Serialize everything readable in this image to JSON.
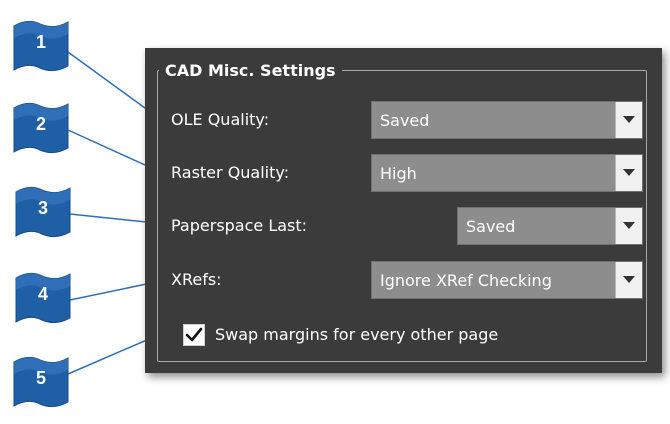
{
  "group": {
    "title": "CAD Misc. Settings"
  },
  "fields": [
    {
      "label": "OLE Quality:",
      "value": "Saved"
    },
    {
      "label": "Raster Quality:",
      "value": "High"
    },
    {
      "label": "Paperspace Last:",
      "value": "Saved"
    },
    {
      "label": "XRefs:",
      "value": "Ignore XRef Checking"
    }
  ],
  "swap_margins": {
    "label": "Swap margins for every other page",
    "checked": true
  },
  "callouts": [
    "1",
    "2",
    "3",
    "4",
    "5"
  ],
  "colors": {
    "panel": "#3b3b3b",
    "combo": "#8d8d8d",
    "callout_blue": "#1f5fa5",
    "leader_line": "#2f6fb5",
    "dot": "#cc1f1f"
  }
}
